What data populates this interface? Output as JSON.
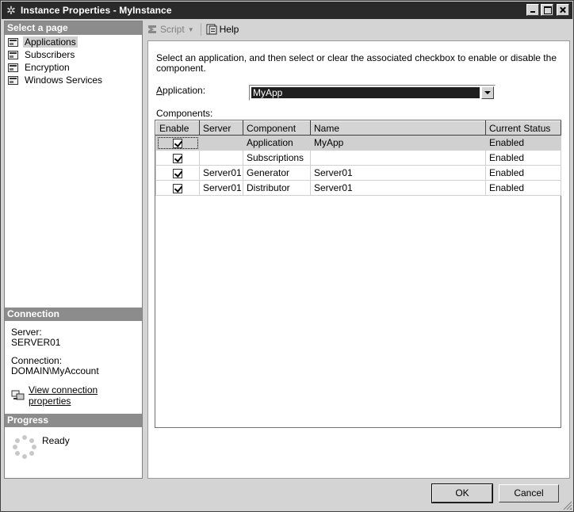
{
  "window": {
    "title": "Instance Properties - MyInstance"
  },
  "left_panel": {
    "select_page_header": "Select a page",
    "pages": [
      {
        "label": "Applications",
        "selected": true,
        "icon": "properties-page-icon"
      },
      {
        "label": "Subscribers",
        "selected": false,
        "icon": "properties-page-icon"
      },
      {
        "label": "Encryption",
        "selected": false,
        "icon": "properties-page-icon"
      },
      {
        "label": "Windows Services",
        "selected": false,
        "icon": "properties-page-icon"
      }
    ],
    "connection": {
      "header": "Connection",
      "server_label": "Server:",
      "server_value": "SERVER01",
      "connection_label": "Connection:",
      "connection_value": "DOMAIN\\MyAccount",
      "link_label": "View connection properties"
    },
    "progress": {
      "header": "Progress",
      "status": "Ready"
    }
  },
  "toolbar": {
    "script_label": "Script",
    "help_label": "Help"
  },
  "content": {
    "description": "Select an application, and then select or clear the associated checkbox to enable or disable the component.",
    "application_label_prefix": "A",
    "application_label_rest": "pplication:",
    "application_value": "MyApp",
    "components_label": "Components:",
    "columns": [
      "Enable",
      "Server",
      "Component",
      "Name",
      "Current Status"
    ],
    "rows": [
      {
        "enabled": true,
        "server": "",
        "component": "Application",
        "name": "MyApp",
        "status": "Enabled"
      },
      {
        "enabled": true,
        "server": "",
        "component": "Subscriptions",
        "name": "",
        "status": "Enabled"
      },
      {
        "enabled": true,
        "server": "Server01",
        "component": "Generator",
        "name": "Server01",
        "status": "Enabled"
      },
      {
        "enabled": true,
        "server": "Server01",
        "component": "Distributor",
        "name": "Server01",
        "status": "Enabled"
      }
    ]
  },
  "footer": {
    "ok_label": "OK",
    "cancel_label": "Cancel"
  },
  "colors": {
    "titlebar": "#2a2a2a",
    "section_header": "#8c8c8c",
    "selection": "#1e1e1e"
  }
}
